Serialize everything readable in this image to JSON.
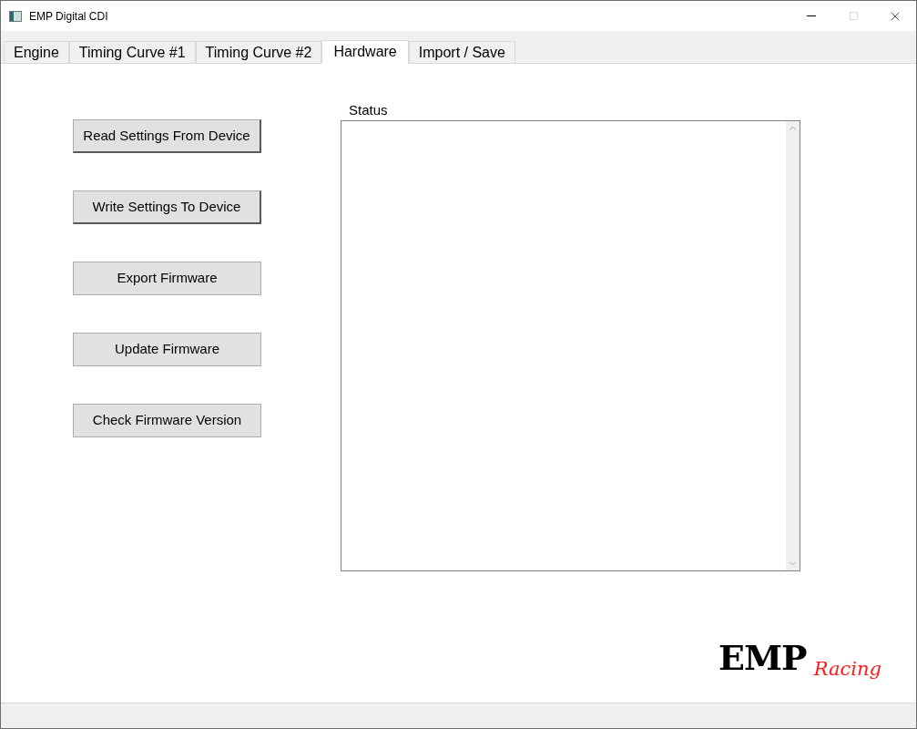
{
  "window": {
    "title": "EMP Digital CDI"
  },
  "tabs": [
    {
      "label": "Engine",
      "selected": false
    },
    {
      "label": "Timing Curve #1",
      "selected": false
    },
    {
      "label": "Timing Curve #2",
      "selected": false
    },
    {
      "label": "Hardware",
      "selected": true
    },
    {
      "label": "Import / Save",
      "selected": false
    }
  ],
  "buttons": [
    {
      "label": "Read Settings From Device",
      "kind": "raised"
    },
    {
      "label": "Write Settings To Device",
      "kind": "raised"
    },
    {
      "label": "Export Firmware",
      "kind": "flat"
    },
    {
      "label": "Update Firmware",
      "kind": "flat"
    },
    {
      "label": "Check Firmware Version",
      "kind": "flat"
    }
  ],
  "status": {
    "label": "Status"
  },
  "logo": {
    "brand": "EMP",
    "tagline": "Racing"
  }
}
